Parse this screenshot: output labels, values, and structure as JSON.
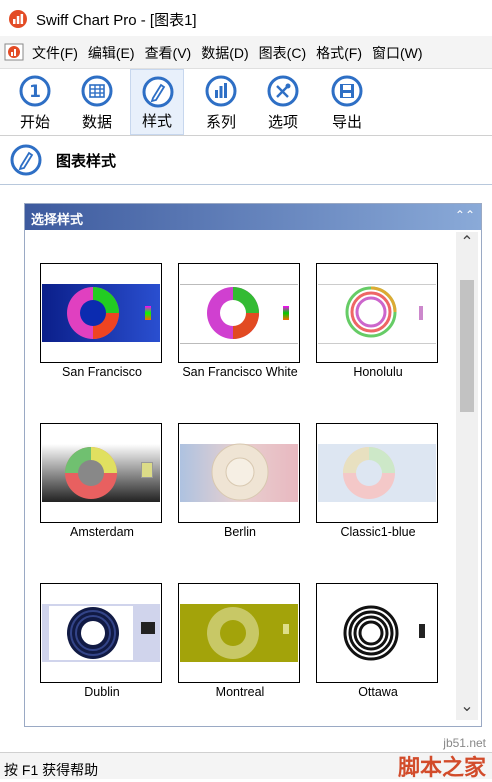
{
  "window": {
    "title": "Swiff Chart Pro - [图表1]"
  },
  "menu": [
    "文件(F)",
    "编辑(E)",
    "查看(V)",
    "数据(D)",
    "图表(C)",
    "格式(F)",
    "窗口(W)"
  ],
  "toolbar": [
    {
      "label": "开始",
      "icon": "step-one-icon"
    },
    {
      "label": "数据",
      "icon": "data-table-icon"
    },
    {
      "label": "样式",
      "icon": "style-pencil-icon"
    },
    {
      "label": "系列",
      "icon": "series-bars-icon"
    },
    {
      "label": "选项",
      "icon": "options-tools-icon"
    },
    {
      "label": "导出",
      "icon": "export-disk-icon"
    }
  ],
  "section": {
    "title": "图表样式"
  },
  "panel": {
    "title": "选择样式"
  },
  "styles": [
    {
      "name": "San Francisco"
    },
    {
      "name": "San Francisco White"
    },
    {
      "name": "Honolulu"
    },
    {
      "name": "Amsterdam"
    },
    {
      "name": "Berlin"
    },
    {
      "name": "Classic1-blue"
    },
    {
      "name": "Dublin"
    },
    {
      "name": "Montreal"
    },
    {
      "name": "Ottawa"
    }
  ],
  "status": {
    "text": "按 F1 获得帮助"
  },
  "watermark": {
    "url": "jb51.net",
    "name": "脚本之家"
  },
  "colors": {
    "accent": "#3d5a9e",
    "icon_blue": "#2e6fc5",
    "watermark": "#d24b2a"
  }
}
